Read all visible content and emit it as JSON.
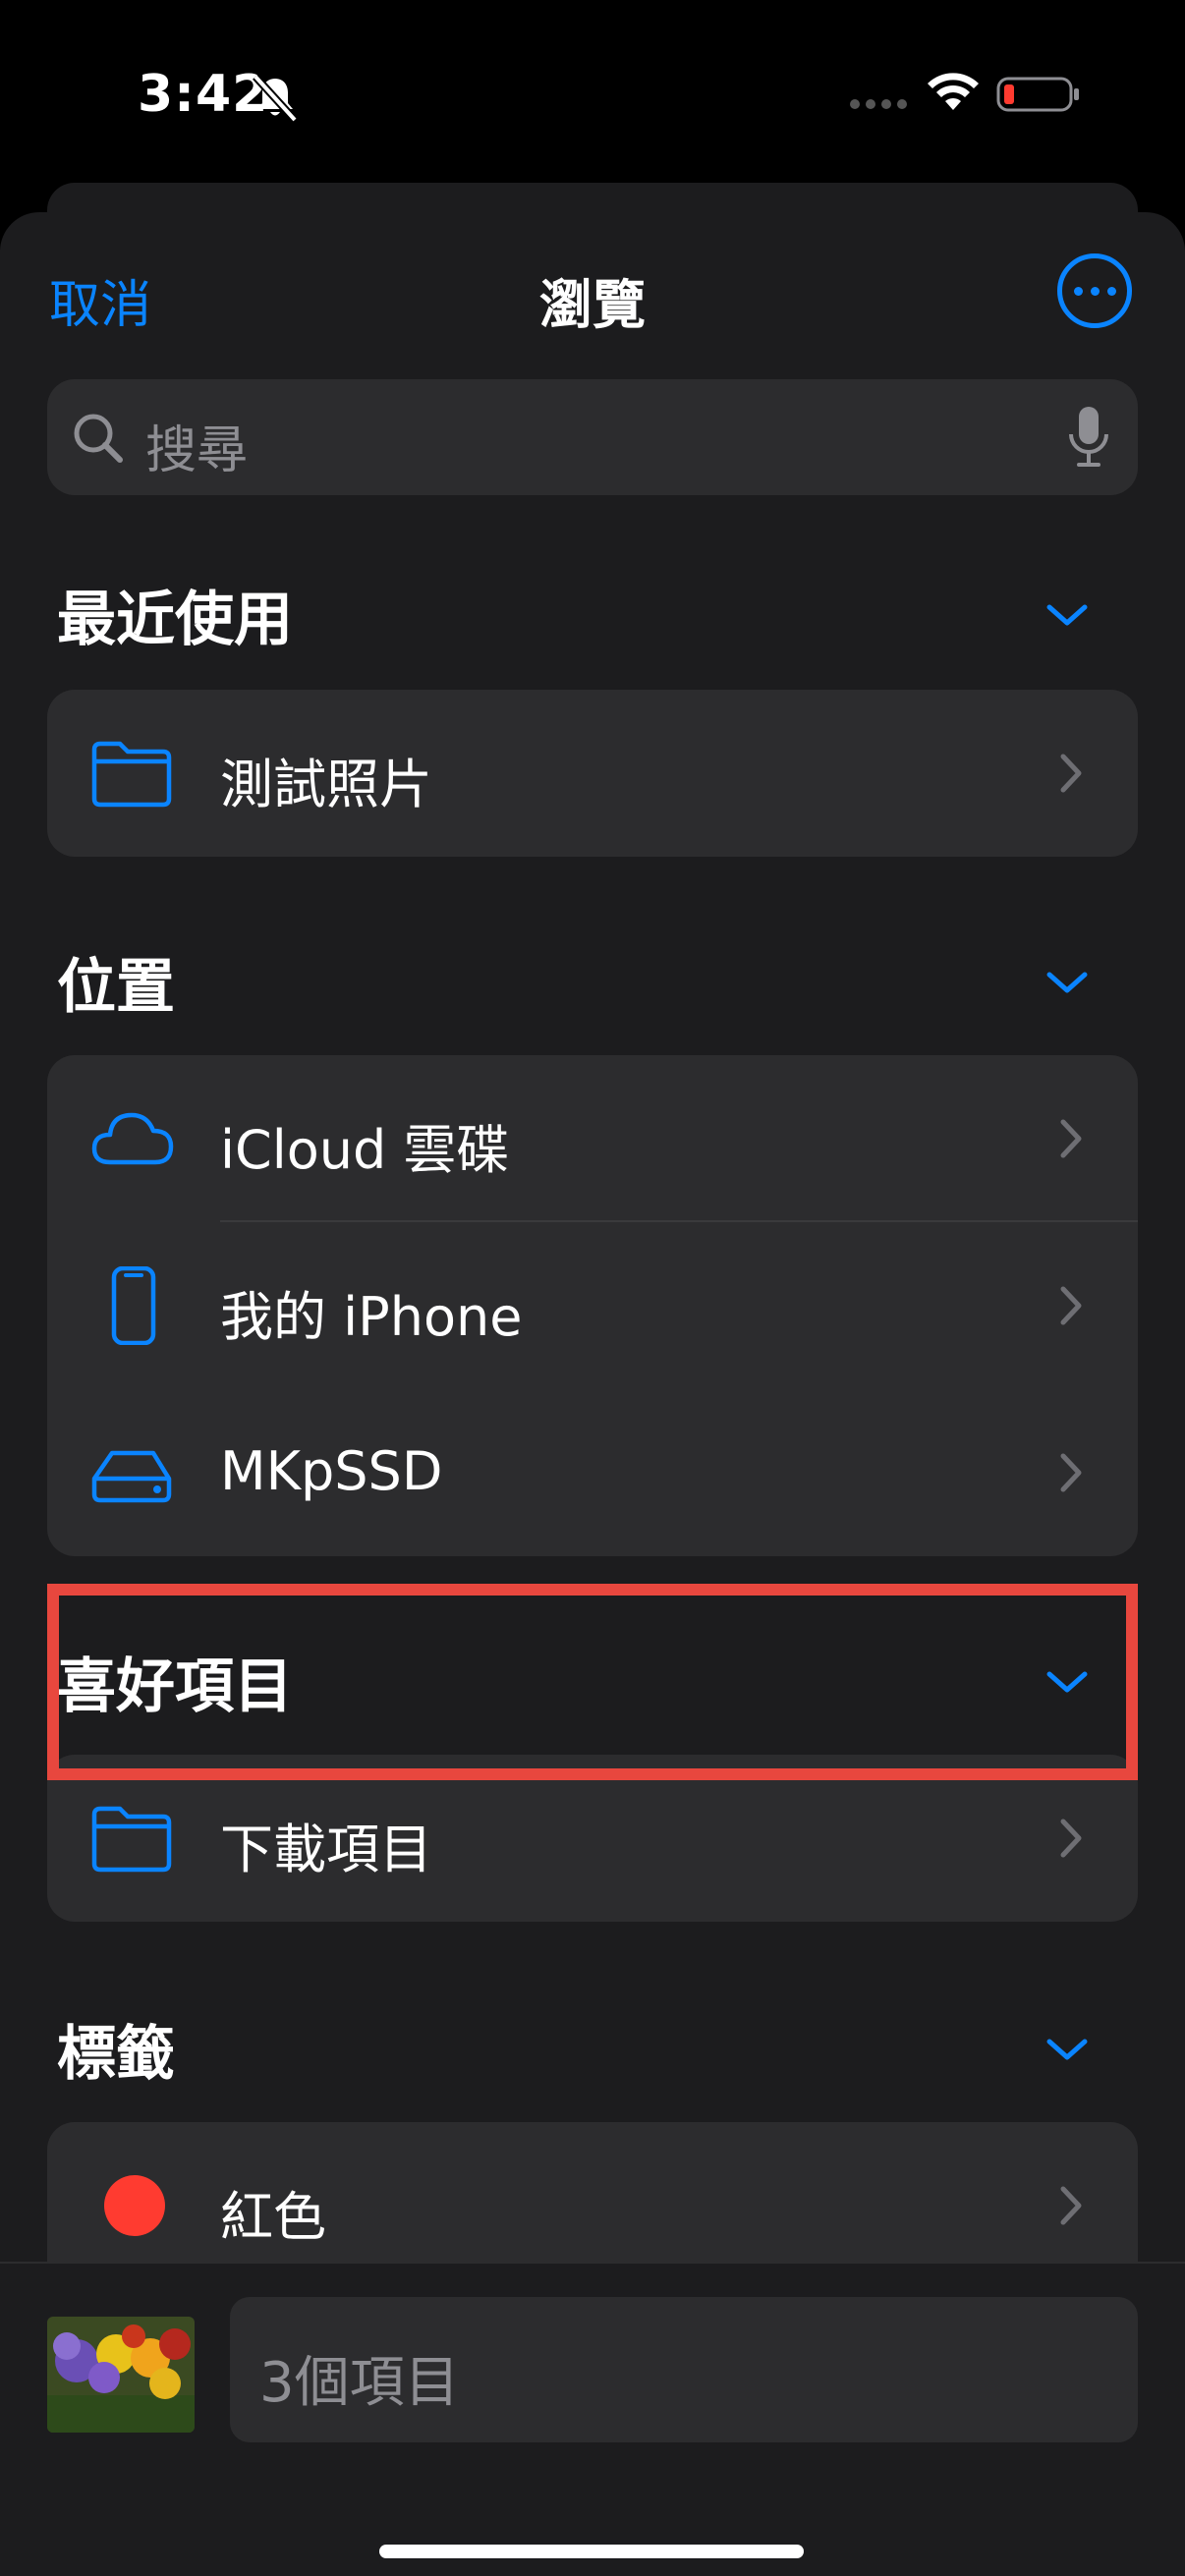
{
  "status_bar": {
    "time": "3:42"
  },
  "nav": {
    "cancel_label": "取消",
    "title": "瀏覽"
  },
  "search": {
    "placeholder": "搜尋"
  },
  "sections": {
    "recent": {
      "title": "最近使用",
      "items": [
        {
          "label": "測試照片",
          "icon": "folder-icon"
        }
      ]
    },
    "locations": {
      "title": "位置",
      "items": [
        {
          "label": "iCloud 雲碟",
          "icon": "cloud-icon"
        },
        {
          "label": "我的 iPhone",
          "icon": "iphone-icon"
        },
        {
          "label": "MKpSSD",
          "icon": "drive-icon",
          "highlighted": true
        }
      ]
    },
    "favorites": {
      "title": "喜好項目",
      "items": [
        {
          "label": "下載項目",
          "icon": "folder-icon"
        }
      ]
    },
    "tags": {
      "title": "標籤",
      "items": [
        {
          "label": "紅色",
          "color": "#ff3b30"
        }
      ]
    }
  },
  "bottom_bar": {
    "item_count": "3個項目"
  },
  "colors": {
    "accent": "#0a84ff",
    "highlight": "#e8473e",
    "tag_red": "#ff3b30"
  }
}
